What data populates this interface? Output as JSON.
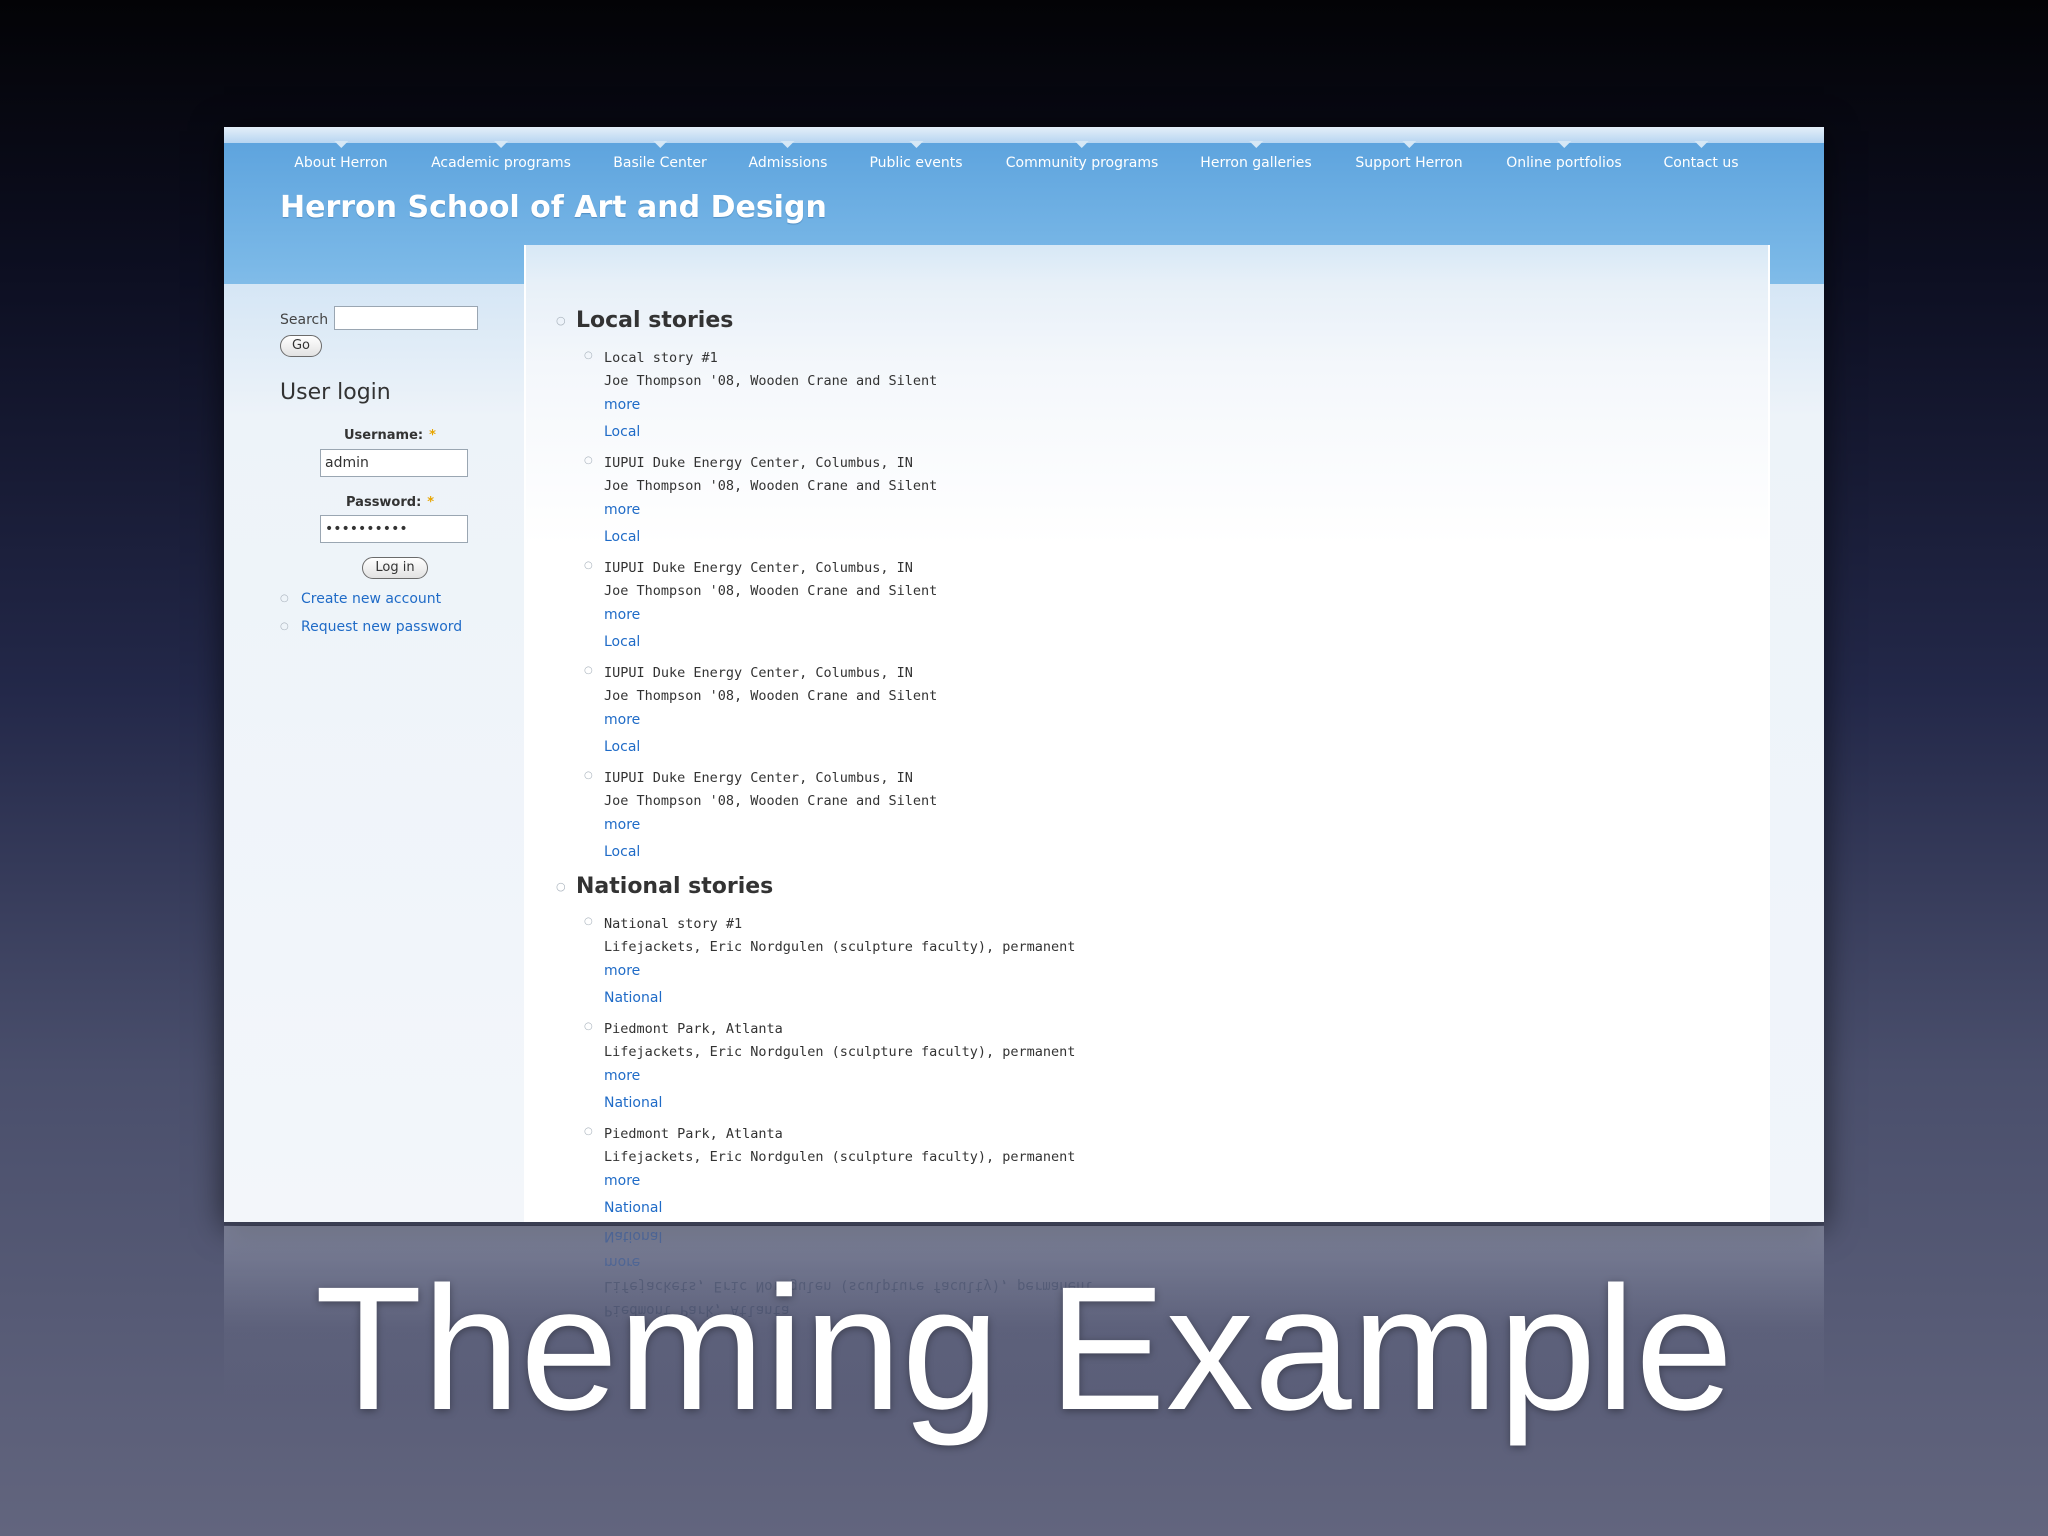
{
  "slide": {
    "title": "Theming Example"
  },
  "site": {
    "title": "Herron School of Art and Design",
    "nav": [
      "About Herron",
      "Academic programs",
      "Basile Center",
      "Admissions",
      "Public events",
      "Community programs",
      "Herron galleries",
      "Support Herron",
      "Online portfolios",
      "Contact us"
    ]
  },
  "sidebar": {
    "search": {
      "label": "Search",
      "value": "",
      "go": "Go"
    },
    "login": {
      "title": "User login",
      "username_label": "Username:",
      "username_value": "admin",
      "password_label": "Password:",
      "password_value": "••••••••••",
      "required_mark": "*",
      "button": "Log in",
      "links": [
        "Create new account",
        "Request new password"
      ]
    }
  },
  "content": {
    "local": {
      "title": "Local stories",
      "items": [
        {
          "title": "Local story #1",
          "desc": "Joe Thompson '08, Wooden Crane and Silent",
          "more": "more",
          "tag": "Local"
        },
        {
          "title": "IUPUI Duke Energy Center, Columbus, IN",
          "desc": "Joe Thompson '08, Wooden Crane and Silent",
          "more": "more",
          "tag": "Local"
        },
        {
          "title": "IUPUI Duke Energy Center, Columbus, IN",
          "desc": "Joe Thompson '08, Wooden Crane and Silent",
          "more": "more",
          "tag": "Local"
        },
        {
          "title": "IUPUI Duke Energy Center, Columbus, IN",
          "desc": "Joe Thompson '08, Wooden Crane and Silent",
          "more": "more",
          "tag": "Local"
        },
        {
          "title": "IUPUI Duke Energy Center, Columbus, IN",
          "desc": "Joe Thompson '08, Wooden Crane and Silent",
          "more": "more",
          "tag": "Local"
        }
      ]
    },
    "national": {
      "title": "National stories",
      "items": [
        {
          "title": "National story #1",
          "desc": "Lifejackets, Eric Nordgulen (sculpture faculty), permanent",
          "more": "more",
          "tag": "National"
        },
        {
          "title": "Piedmont Park, Atlanta",
          "desc": "Lifejackets, Eric Nordgulen (sculpture faculty), permanent",
          "more": "more",
          "tag": "National"
        },
        {
          "title": "Piedmont Park, Atlanta",
          "desc": "Lifejackets, Eric Nordgulen (sculpture faculty), permanent",
          "more": "more",
          "tag": "National"
        }
      ]
    }
  }
}
